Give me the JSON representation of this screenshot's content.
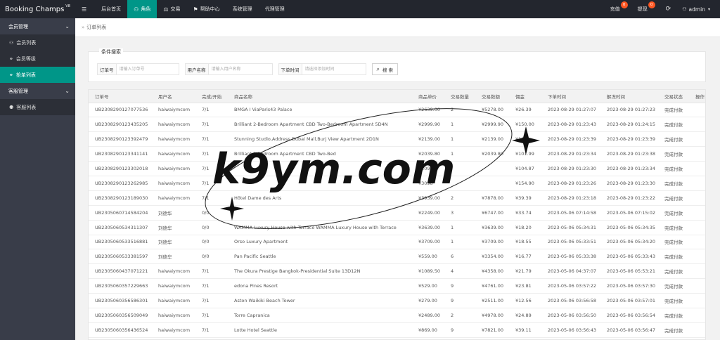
{
  "app": {
    "title": "Booking Champs",
    "version": "V8"
  },
  "nav": [
    {
      "icon": "menu-icon",
      "glyph": "☰",
      "label": ""
    },
    {
      "icon": "",
      "glyph": "",
      "label": "后台首页"
    },
    {
      "icon": "user-icon",
      "glyph": "⚇",
      "label": "角色",
      "active": true
    },
    {
      "icon": "scale-icon",
      "glyph": "⚖",
      "label": "交易"
    },
    {
      "icon": "flag-icon",
      "glyph": "⚑",
      "label": "帮助中心"
    },
    {
      "icon": "",
      "glyph": "",
      "label": "系统管理"
    },
    {
      "icon": "",
      "glyph": "",
      "label": "代理管理"
    }
  ],
  "topright": {
    "recharge_label": "充值",
    "recharge_count": "0",
    "withdraw_label": "提现",
    "withdraw_count": "0",
    "refresh_glyph": "⟳",
    "user_label": "admin"
  },
  "sidebar": {
    "groups": [
      {
        "label": "会员管理",
        "items": [
          {
            "label": "会员列表",
            "glyph": "⚇"
          },
          {
            "label": "会员等级",
            "glyph": "⚭"
          },
          {
            "label": "抢单列表",
            "glyph": "⚭",
            "active": true
          }
        ]
      },
      {
        "label": "客服管理",
        "items": [
          {
            "label": "客服列表",
            "glyph": "⚉"
          }
        ]
      }
    ]
  },
  "breadcrumb": {
    "glyph": "»",
    "label": "订单列表"
  },
  "search": {
    "legend": "条件搜索",
    "order_label": "订单号",
    "order_placeholder": "请输入订单号",
    "user_label": "用户名称",
    "user_placeholder": "请输入用户名称",
    "time_label": "下单时间",
    "time_placeholder": "请选择添加时间",
    "button_label": "搜 索"
  },
  "table": {
    "headers": [
      "订单号",
      "用户名",
      "完成/开始",
      "商品名称",
      "商品单价",
      "交易数量",
      "交易数额",
      "佣金",
      "下单时间",
      "解冻时间",
      "交易状态",
      "操作"
    ],
    "rows": [
      [
        "UB2308290127077536",
        "haiwaiymcom",
        "7/1",
        "BMGA I ViaParis43 Palace",
        "¥2639.00",
        "2",
        "¥5278.00",
        "¥26.39",
        "2023-08-29 01:27:07",
        "2023-08-29 01:27:23",
        "完成付款",
        ""
      ],
      [
        "UB2308290123435205",
        "haiwaiymcom",
        "7/1",
        "Brilliant 2-Bedroom Apartment CBD Two-Bedroom Apartment 5D4N",
        "¥2999.90",
        "1",
        "¥2999.90",
        "¥150.00",
        "2023-08-29 01:23:43",
        "2023-08-29 01:24:15",
        "完成付款",
        ""
      ],
      [
        "UB2308290123392479",
        "haiwaiymcom",
        "7/1",
        "Stunning Studio,Address Dubai Mall,Burj View Apartment 2D1N",
        "¥2139.00",
        "1",
        "¥2139.00",
        "¥10",
        "2023-08-29 01:23:39",
        "2023-08-29 01:23:39",
        "完成付款",
        ""
      ],
      [
        "UB2308290123341141",
        "haiwaiymcom",
        "7/1",
        "Brilliant 2-Bedroom Apartment CBD Two-Bed",
        "¥2039.80",
        "1",
        "¥2039.80",
        "¥101.99",
        "2023-08-29 01:23:34",
        "2023-08-29 01:23:38",
        "完成付款",
        ""
      ],
      [
        "UB2308290123302018",
        "haiwaiymcom",
        "7/1",
        "",
        "¥2097",
        "",
        "",
        "¥104.87",
        "2023-08-29 01:23:30",
        "2023-08-29 01:23:34",
        "完成付款",
        ""
      ],
      [
        "UB2308290123262985",
        "haiwaiymcom",
        "7/1",
        "",
        "¥3098",
        "",
        "",
        "¥154.90",
        "2023-08-29 01:23:26",
        "2023-08-29 01:23:30",
        "完成付款",
        ""
      ],
      [
        "UB2308290123189030",
        "haiwaiymcom",
        "7/1",
        "Hôtel Dame des Arts",
        "¥3939.00",
        "2",
        "¥7878.00",
        "¥39.39",
        "2023-08-29 01:23:18",
        "2023-08-29 01:23:22",
        "完成付款",
        ""
      ],
      [
        "UB2305060714584204",
        "刘德华",
        "0/0",
        "",
        "¥2249.00",
        "3",
        "¥6747.00",
        "¥33.74",
        "2023-05-06 07:14:58",
        "2023-05-06 07:15:02",
        "完成付款",
        ""
      ],
      [
        "UB2305060534311307",
        "刘德华",
        "0/0",
        "WAMMA Luxury House with Terrace WAMMA Luxury House with Terrace",
        "¥3639.00",
        "1",
        "¥3639.00",
        "¥18.20",
        "2023-05-06 05:34:31",
        "2023-05-06 05:34:35",
        "完成付款",
        ""
      ],
      [
        "UB2305060533516881",
        "刘德华",
        "0/0",
        "Orso Luxury Apartment",
        "¥3709.00",
        "1",
        "¥3709.00",
        "¥18.55",
        "2023-05-06 05:33:51",
        "2023-05-06 05:34:20",
        "完成付款",
        ""
      ],
      [
        "UB2305060533381597",
        "刘德华",
        "0/0",
        "Pan Pacific Seattle",
        "¥559.00",
        "6",
        "¥3354.00",
        "¥16.77",
        "2023-05-06 05:33:38",
        "2023-05-06 05:33:43",
        "完成付款",
        ""
      ],
      [
        "UB2305060437071221",
        "haiwaiymcom",
        "7/1",
        "The Okura Prestige Bangkok-Presidential Suite 13D12N",
        "¥1089.50",
        "4",
        "¥4358.00",
        "¥21.79",
        "2023-05-06 04:37:07",
        "2023-05-06 05:53:21",
        "完成付款",
        ""
      ],
      [
        "UB2305060357229663",
        "haiwaiymcom",
        "7/1",
        "edona Pines Resort",
        "¥529.00",
        "9",
        "¥4761.00",
        "¥23.81",
        "2023-05-06 03:57:22",
        "2023-05-06 03:57:30",
        "完成付款",
        ""
      ],
      [
        "UB2305060356586301",
        "haiwaiymcom",
        "7/1",
        "Aston Waikiki Beach Tower",
        "¥279.00",
        "9",
        "¥2511.00",
        "¥12.56",
        "2023-05-06 03:56:58",
        "2023-05-06 03:57:01",
        "完成付款",
        ""
      ],
      [
        "UB2305060356509049",
        "haiwaiymcom",
        "7/1",
        "Torre Capranica",
        "¥2489.00",
        "2",
        "¥4978.00",
        "¥24.89",
        "2023-05-06 03:56:50",
        "2023-05-06 03:56:54",
        "完成付款",
        ""
      ],
      [
        "UB2305060356436524",
        "haiwaiymcom",
        "7/1",
        "Lotte Hotel Seattle",
        "¥869.00",
        "9",
        "¥7821.00",
        "¥39.11",
        "2023-05-06 03:56:43",
        "2023-05-06 03:56:47",
        "完成付款",
        ""
      ]
    ]
  },
  "watermark": {
    "text": "k9ym.com"
  }
}
